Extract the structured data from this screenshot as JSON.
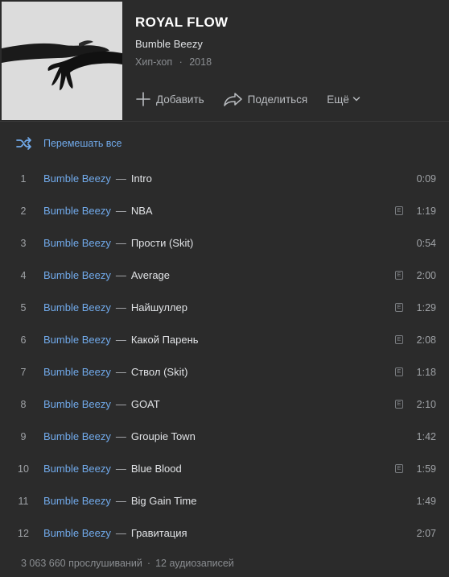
{
  "album": {
    "title": "ROYAL FLOW",
    "artist": "Bumble Beezy",
    "genre": "Хип-хоп",
    "year": "2018",
    "separator": "·"
  },
  "actions": {
    "add_label": "Добавить",
    "share_label": "Поделиться",
    "more_label": "Ещё"
  },
  "shuffle_label": "Перемешать все",
  "track_separator": "—",
  "explicit_mark": "E",
  "tracks": [
    {
      "num": "1",
      "artist": "Bumble Beezy",
      "title": "Intro",
      "duration": "0:09",
      "explicit": false
    },
    {
      "num": "2",
      "artist": "Bumble Beezy",
      "title": "NBA",
      "duration": "1:19",
      "explicit": true
    },
    {
      "num": "3",
      "artist": "Bumble Beezy",
      "title": "Прости (Skit)",
      "duration": "0:54",
      "explicit": false
    },
    {
      "num": "4",
      "artist": "Bumble Beezy",
      "title": "Average",
      "duration": "2:00",
      "explicit": true
    },
    {
      "num": "5",
      "artist": "Bumble Beezy",
      "title": "Найшуллер",
      "duration": "1:29",
      "explicit": true
    },
    {
      "num": "6",
      "artist": "Bumble Beezy",
      "title": "Какой Парень",
      "duration": "2:08",
      "explicit": true
    },
    {
      "num": "7",
      "artist": "Bumble Beezy",
      "title": "Ствол (Skit)",
      "duration": "1:18",
      "explicit": true
    },
    {
      "num": "8",
      "artist": "Bumble Beezy",
      "title": "GOAT",
      "duration": "2:10",
      "explicit": true
    },
    {
      "num": "9",
      "artist": "Bumble Beezy",
      "title": "Groupie Town",
      "duration": "1:42",
      "explicit": false
    },
    {
      "num": "10",
      "artist": "Bumble Beezy",
      "title": "Blue Blood",
      "duration": "1:59",
      "explicit": true
    },
    {
      "num": "11",
      "artist": "Bumble Beezy",
      "title": "Big Gain Time",
      "duration": "1:49",
      "explicit": false
    },
    {
      "num": "12",
      "artist": "Bumble Beezy",
      "title": "Гравитация",
      "duration": "2:07",
      "explicit": false
    }
  ],
  "footer": {
    "plays": "3 063 660 прослушиваний",
    "separator": "·",
    "count": "12 аудиозаписей"
  },
  "icons": {
    "add": "plus-icon",
    "share": "share-arrow-icon",
    "more": "chevron-down-icon",
    "shuffle": "shuffle-icon",
    "explicit": "explicit-icon"
  },
  "colors": {
    "background": "#2b2b2b",
    "accent": "#71aaeb",
    "text": "#e1e3e6",
    "muted": "#8a8d91"
  }
}
